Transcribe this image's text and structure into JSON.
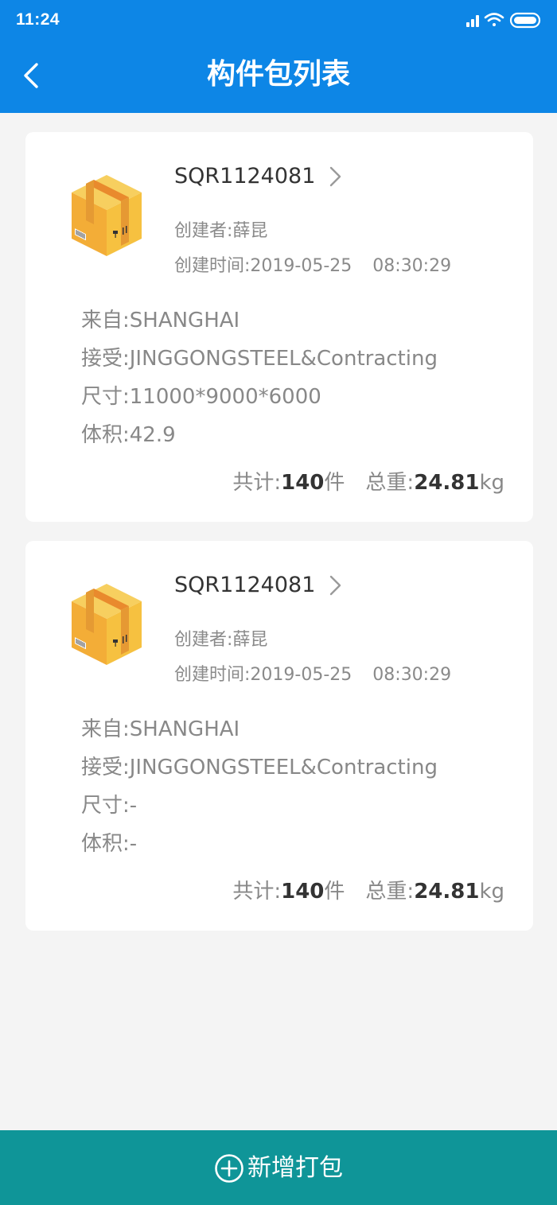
{
  "status_bar": {
    "time": "11:24",
    "icons": [
      "signal-icon",
      "wifi-icon",
      "battery-icon"
    ]
  },
  "header": {
    "title": "构件包列表",
    "back_icon": "chevron-left-icon"
  },
  "packages": [
    {
      "id": "SQR1124081",
      "creator": "创建者:薛昆",
      "created_label": "创建时间:",
      "created_date": "2019-05-25",
      "created_time": "08:30:29",
      "from": "来自:SHANGHAI",
      "to": "接受:JINGGONGSTEEL&Contracting",
      "size": "尺寸:11000*9000*6000",
      "volume": "体积:42.9",
      "total_label": "共计:",
      "total_count": "140",
      "total_unit": "件",
      "weight_label": "总重:",
      "weight_value": "24.81",
      "weight_unit": "kg"
    },
    {
      "id": "SQR1124081",
      "creator": "创建者:薛昆",
      "created_label": "创建时间:",
      "created_date": "2019-05-25",
      "created_time": "08:30:29",
      "from": "来自:SHANGHAI",
      "to": "接受:JINGGONGSTEEL&Contracting",
      "size": "尺寸:-",
      "volume": "体积:-",
      "total_label": "共计:",
      "total_count": "140",
      "total_unit": "件",
      "weight_label": "总重:",
      "weight_value": "24.81",
      "weight_unit": "kg"
    }
  ],
  "bottom_button": {
    "label": "新增打包",
    "icon": "plus-circle-icon"
  },
  "colors": {
    "header_bg": "#0d86e6",
    "page_bg": "#f4f4f4",
    "card_bg": "#ffffff",
    "bottom_bg": "#0f9598",
    "text_dark": "#333333",
    "text_gray": "#888888"
  }
}
